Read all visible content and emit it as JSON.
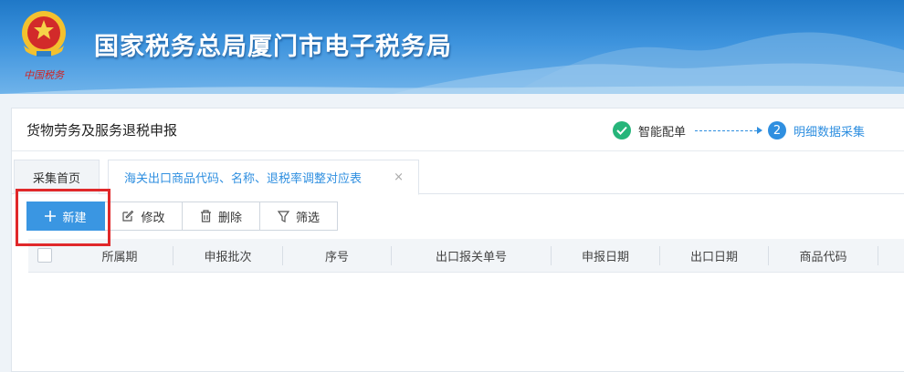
{
  "header": {
    "site_title": "国家税务总局厦门市电子税务局",
    "emblem_caption": "中国税务"
  },
  "page": {
    "title": "货物劳务及服务退税申报"
  },
  "steps": [
    {
      "label": "智能配单",
      "state": "done",
      "icon": "check-icon"
    },
    {
      "label": "明细数据采集",
      "state": "active",
      "number": "2"
    }
  ],
  "tabs": {
    "home_label": "采集首页",
    "active_label": "海关出口商品代码、名称、退税率调整对应表",
    "close_glyph": "×"
  },
  "toolbar": {
    "new_label": "新建",
    "edit_label": "修改",
    "delete_label": "删除",
    "filter_label": "筛选"
  },
  "table": {
    "columns": [
      "所属期",
      "申报批次",
      "序号",
      "出口报关单号",
      "申报日期",
      "出口日期",
      "商品代码"
    ]
  },
  "colors": {
    "primary": "#3a96e2",
    "success": "#26b57a",
    "highlight": "#e0282a"
  }
}
